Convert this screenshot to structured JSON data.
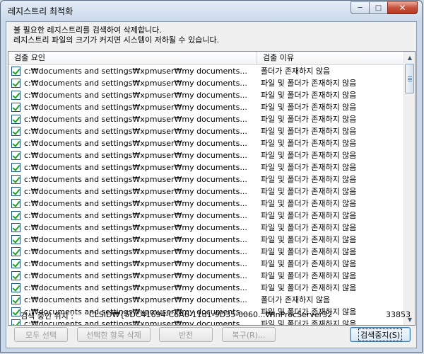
{
  "window": {
    "title": "레지스트리 최적화"
  },
  "description": {
    "line1": "불 필요한 레지스트리를 검색하여 삭제합니다.",
    "line2": "레지스트리 파일의 크기가 커지면 시스템이 저하될 수 있습니다."
  },
  "list": {
    "columns": [
      "검출 요인",
      "검출 이유"
    ],
    "rows": [
      {
        "checked": true,
        "path": "c:₩documents and settings₩xpmuser₩my documents...",
        "reason": "폴더가 존재하지 않음"
      },
      {
        "checked": true,
        "path": "c:₩documents and settings₩xpmuser₩my documents...",
        "reason": "파일 및 폴더가 존재하지 않음"
      },
      {
        "checked": true,
        "path": "c:₩documents and settings₩xpmuser₩my documents...",
        "reason": "파일 및 폴더가 존재하지 않음"
      },
      {
        "checked": true,
        "path": "c:₩documents and settings₩xpmuser₩my documents...",
        "reason": "파일 및 폴더가 존재하지 않음"
      },
      {
        "checked": true,
        "path": "c:₩documents and settings₩xpmuser₩my documents...",
        "reason": "파일 및 폴더가 존재하지 않음"
      },
      {
        "checked": true,
        "path": "c:₩documents and settings₩xpmuser₩my documents...",
        "reason": "파일 및 폴더가 존재하지 않음"
      },
      {
        "checked": true,
        "path": "c:₩documents and settings₩xpmuser₩my documents...",
        "reason": "파일 및 폴더가 존재하지 않음"
      },
      {
        "checked": true,
        "path": "c:₩documents and settings₩xpmuser₩my documents...",
        "reason": "파일 및 폴더가 존재하지 않음"
      },
      {
        "checked": true,
        "path": "c:₩documents and settings₩xpmuser₩my documents...",
        "reason": "파일 및 폴더가 존재하지 않음"
      },
      {
        "checked": true,
        "path": "c:₩documents and settings₩xpmuser₩my documents...",
        "reason": "파일 및 폴더가 존재하지 않음"
      },
      {
        "checked": true,
        "path": "c:₩documents and settings₩xpmuser₩my documents...",
        "reason": "파일 및 폴더가 존재하지 않음"
      },
      {
        "checked": true,
        "path": "c:₩documents and settings₩xpmuser₩my documents...",
        "reason": "파일 및 폴더가 존재하지 않음"
      },
      {
        "checked": true,
        "path": "c:₩documents and settings₩xpmuser₩my documents...",
        "reason": "파일 및 폴더가 존재하지 않음"
      },
      {
        "checked": true,
        "path": "c:₩documents and settings₩xpmuser₩my documents...",
        "reason": "파일 및 폴더가 존재하지 않음"
      },
      {
        "checked": true,
        "path": "c:₩documents and settings₩xpmuser₩my documents...",
        "reason": "파일 및 폴더가 존재하지 않음"
      },
      {
        "checked": true,
        "path": "c:₩documents and settings₩xpmuser₩my documents...",
        "reason": "파일 및 폴더가 존재하지 않음"
      },
      {
        "checked": true,
        "path": "c:₩documents and settings₩xpmuser₩my documents...",
        "reason": "파일 및 폴더가 존재하지 않음"
      },
      {
        "checked": true,
        "path": "c:₩documents and settings₩xpmuser₩my documents...",
        "reason": "파일 및 폴더가 존재하지 않음"
      },
      {
        "checked": true,
        "path": "c:₩documents and settings₩xpmuser₩my documents...",
        "reason": "파일 및 폴더가 존재하지 않음"
      },
      {
        "checked": true,
        "path": "c:₩documents and settings₩xpmuser₩my documents...",
        "reason": "폴더가 존재하지 않음"
      },
      {
        "checked": true,
        "path": "c:₩documents and settings₩xpmuser₩my documents...",
        "reason": "파일 및 폴더가 존재하지 않음"
      },
      {
        "checked": true,
        "path": "c:₩documents and settings₩xpmuser₩my documents...",
        "reason": "파일 및 폴더가 존재하지 않음"
      }
    ]
  },
  "status": {
    "label": "검색 중인 위치 :",
    "path": "CLSID₩{5DC41694-C6A6-11d1-9D35-0060...₩InProcServer32",
    "count": "33853"
  },
  "buttons": {
    "select_all": "모두 선택",
    "delete_selected": "선택한 항목 삭제",
    "invert": "반전",
    "restore": "복구(R)...",
    "stop_search": "검색중지(S)"
  }
}
